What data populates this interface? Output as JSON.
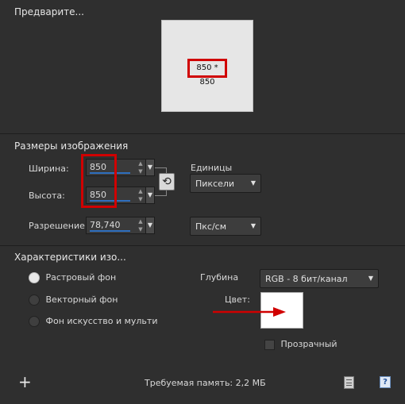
{
  "preview": {
    "title": "Предварите...",
    "size_label": "850 * 850"
  },
  "dimensions": {
    "title": "Размеры изображения",
    "width_label": "Ширина:",
    "width_value": "850",
    "height_label": "Высота:",
    "height_value": "850",
    "resolution_label": "Разрешение:",
    "resolution_value": "78,740",
    "units_label": "Единицы",
    "units_value": "Пиксели",
    "resolution_units_value": "Пкс/см"
  },
  "characteristics": {
    "title": "Характеристики изо...",
    "options": [
      "Растровый фон",
      "Векторный фон",
      "Фон искусство и мульти"
    ],
    "depth_label": "Глубина",
    "depth_value": "RGB - 8 бит/канал",
    "color_label": "Цвет:",
    "transparent_label": "Прозрачный"
  },
  "footer": {
    "memory_text": "Требуемая память: 2,2 МБ"
  },
  "colors": {
    "accent_red": "#d00000",
    "accent_blue": "#2f6fbf",
    "bg": "#2f2f2f"
  },
  "icons": [
    "plus-icon",
    "link-icon",
    "notes-icon",
    "help-icon",
    "arrow-icon"
  ]
}
